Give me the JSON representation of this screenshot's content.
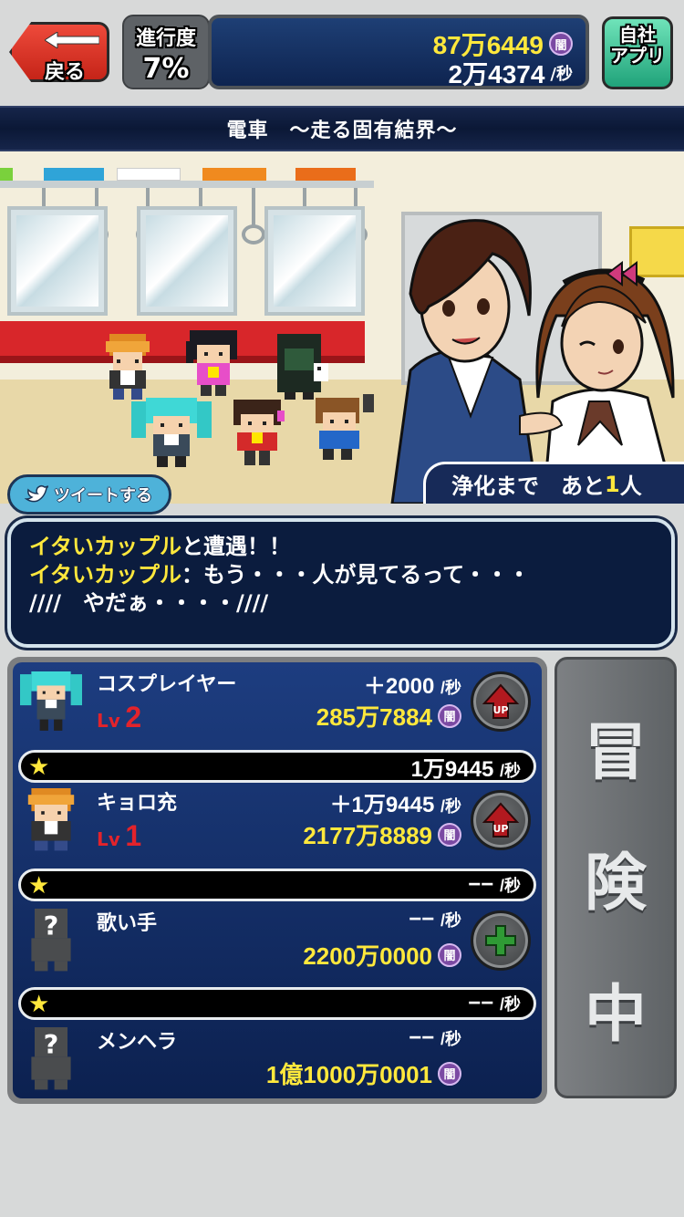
{
  "header": {
    "back_label": "戻る",
    "progress_label": "進行度",
    "progress_value": "7%",
    "total_amount": "87万6449",
    "rate_amount": "2万4374",
    "per_sec": "/秒",
    "currency": "闇",
    "app_label_1": "自社",
    "app_label_2": "アプリ"
  },
  "stage": {
    "title": "電車　～走る固有結界～",
    "purify_label": "浄化まで　あと",
    "purify_count": "1",
    "purify_unit": "人"
  },
  "tweet": {
    "label": "ツイートする"
  },
  "message": {
    "line1_name": "イタいカップル",
    "line1_text": "と遭遇！！",
    "line2_name": "イタいカップル",
    "line2_text": "：もう・・・人が見てるって・・・",
    "line3_text": "////　やだぁ・・・・////"
  },
  "units": [
    {
      "name": "コスプレイヤー",
      "lv_label": "Lv",
      "level": "2",
      "rate": "＋2000",
      "cost": "285万7884",
      "button": "up"
    },
    {
      "name": "キョロ充",
      "lv_label": "Lv",
      "level": "1",
      "rate": "＋1万9445",
      "cost": "2177万8889",
      "button": "up"
    },
    {
      "name": "歌い手",
      "rate": "−−",
      "cost": "2200万0000",
      "button": "add"
    },
    {
      "name": "メンヘラ",
      "rate": "−−",
      "cost": "1億1000万0001",
      "button": "none"
    }
  ],
  "star_bars": [
    {
      "value": "1万9445"
    },
    {
      "value": "−−"
    },
    {
      "value": "−−"
    }
  ],
  "adventure": {
    "char1": "冒",
    "char2": "険",
    "char3": "中"
  },
  "colors": {
    "yellow": "#ffe83c",
    "back_red": "#d62e20",
    "panel_blue": "#1d3d80",
    "level_red": "#e3232b"
  },
  "icons": {
    "back": "left-arrow-icon",
    "tweet": "bird-icon",
    "up": "up-arrow-icon",
    "add": "plus-icon",
    "star": "star-icon"
  }
}
